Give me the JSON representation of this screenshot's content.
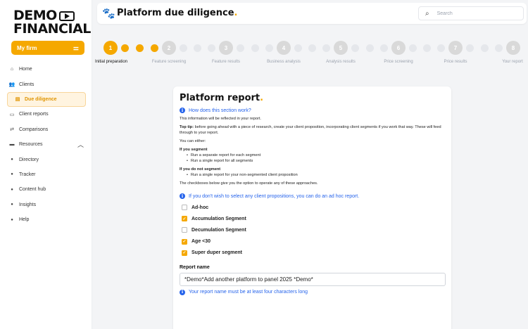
{
  "brand": {
    "line1": "DEMO",
    "line2": "FINANCIAL",
    "accent": "#f5a800"
  },
  "sidebar": {
    "firm_button": "My firm",
    "items": [
      {
        "label": "Home",
        "icon": "home-icon"
      },
      {
        "label": "Clients",
        "icon": "users-icon"
      },
      {
        "label": "Due diligence",
        "icon": "document-icon"
      },
      {
        "label": "Client reports",
        "icon": "report-icon"
      },
      {
        "label": "Comparisons",
        "icon": "compare-icon"
      },
      {
        "label": "Resources",
        "icon": "folder-icon"
      }
    ],
    "sub_items": [
      "Directory",
      "Tracker",
      "Content hub",
      "Insights",
      "Help"
    ]
  },
  "header": {
    "title": "Platform due diligence",
    "dot": ".",
    "search_placeholder": "Search"
  },
  "stepper": {
    "steps": [
      {
        "number": "1",
        "label": "Initial preparation"
      },
      {
        "number": "2",
        "label": "Feature screening"
      },
      {
        "number": "3",
        "label": "Feature results"
      },
      {
        "number": "4",
        "label": "Business analysis"
      },
      {
        "number": "5",
        "label": "Analysis results"
      },
      {
        "number": "6",
        "label": "Price screening"
      },
      {
        "number": "7",
        "label": "Price results"
      },
      {
        "number": "8",
        "label": "Your report"
      }
    ],
    "current_step": 1,
    "completed_substeps": 3
  },
  "card": {
    "title": "Platform report",
    "dot": ".",
    "how_link": "How does this section work?",
    "p1": "This information will be reflected in your report.",
    "toptip_label": "Top tip:",
    "toptip_text": " before going ahead with a piece of research, create your client proposition, incorporating client segments if you work that way. These will feed through to your report.",
    "either": "You can either:",
    "if_segment": "If you segment",
    "segment_bullets": [
      "Run a separate report for each segment",
      "Run a single report for all segments"
    ],
    "if_no_segment": "If you do not segment",
    "no_segment_bullets": [
      "Run a single report for your non-segmented client proposition"
    ],
    "checkbox_note": "The checkboxes below give you the option to operate any of these approaches.",
    "adhoc_link": "If you don't wish to select any client propositions, you can do an ad hoc report.",
    "options": [
      {
        "label": "Ad-hoc",
        "checked": false
      },
      {
        "label": "Accumulation Segment",
        "checked": true
      },
      {
        "label": "Decumulation Segment",
        "checked": false
      },
      {
        "label": "Age <30",
        "checked": true
      },
      {
        "label": "Super duper segment",
        "checked": true
      }
    ],
    "report_name_label": "Report name",
    "report_name_value": "*Demo*Add another platform to panel 2025 *Demo*",
    "report_name_hint": "Your report name must be at least four characters long"
  }
}
